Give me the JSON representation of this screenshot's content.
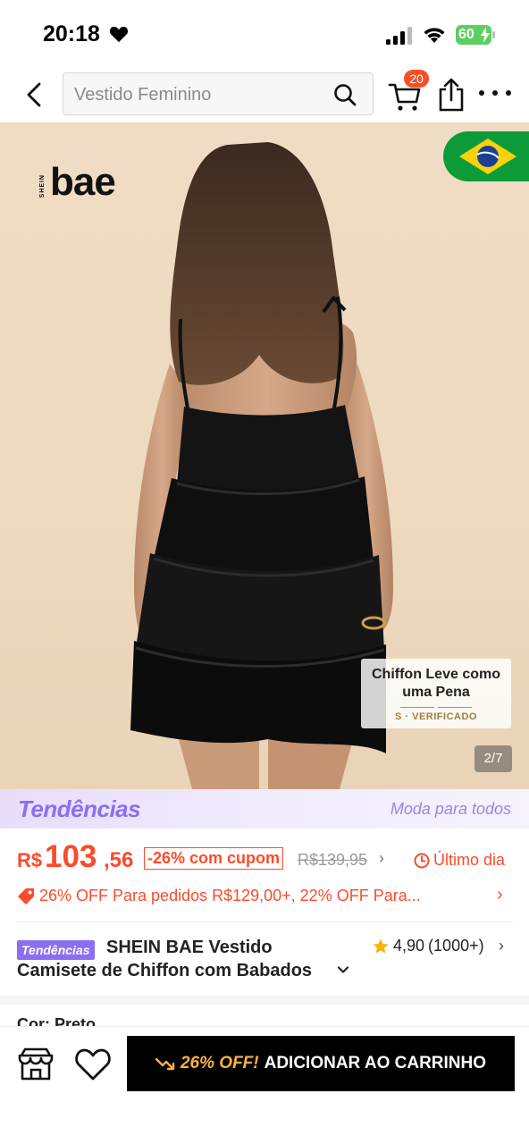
{
  "status_bar": {
    "time": "20:18",
    "battery": "60"
  },
  "header": {
    "search_text": "Vestido Feminino",
    "cart_count": "20"
  },
  "product_image": {
    "brand_small": "SHEIN",
    "brand": "bae",
    "badge_title": "Chiffon Leve como uma Pena",
    "badge_verified": "S · VERIFICADO",
    "counter": "2/7"
  },
  "trends": {
    "logo": "Tendências",
    "tagline": "Moda para todos"
  },
  "price": {
    "currency": "R$",
    "integer": "103",
    "decimals": ",56",
    "coupon": "-26% com cupom",
    "old_price": "R$139,95",
    "last_day": "Último dia"
  },
  "promo": {
    "text": "26% OFF Para pedidos R$129,00+,  22% OFF Para..."
  },
  "title": {
    "tag": "Tendências",
    "line1": "SHEIN BAE Vestido",
    "line2": "Camisete de Chiffon com Babados"
  },
  "rating": {
    "value": "4,90",
    "count": "(1000+)"
  },
  "color_row": {
    "label": "Cor: Preto"
  },
  "bottom_bar": {
    "cta_discount": "26% OFF!",
    "cta_label": "ADICIONAR AO CARRINHO"
  },
  "colors": {
    "accent": "#fa4b2c",
    "trends_purple": "#8a6ff2",
    "cta_background": "#000000",
    "cta_discount": "#ffb33e"
  },
  "icons": [
    "heart-icon",
    "signal-icon",
    "wifi-icon",
    "battery-icon",
    "back-arrow-icon",
    "search-icon",
    "cart-icon",
    "share-icon",
    "more-icon",
    "brazil-flag-icon",
    "clock-icon",
    "tag-icon",
    "star-icon",
    "chevron-down-icon",
    "chevron-right-icon",
    "store-icon",
    "wishlist-heart-icon",
    "trend-arrow-icon"
  ]
}
